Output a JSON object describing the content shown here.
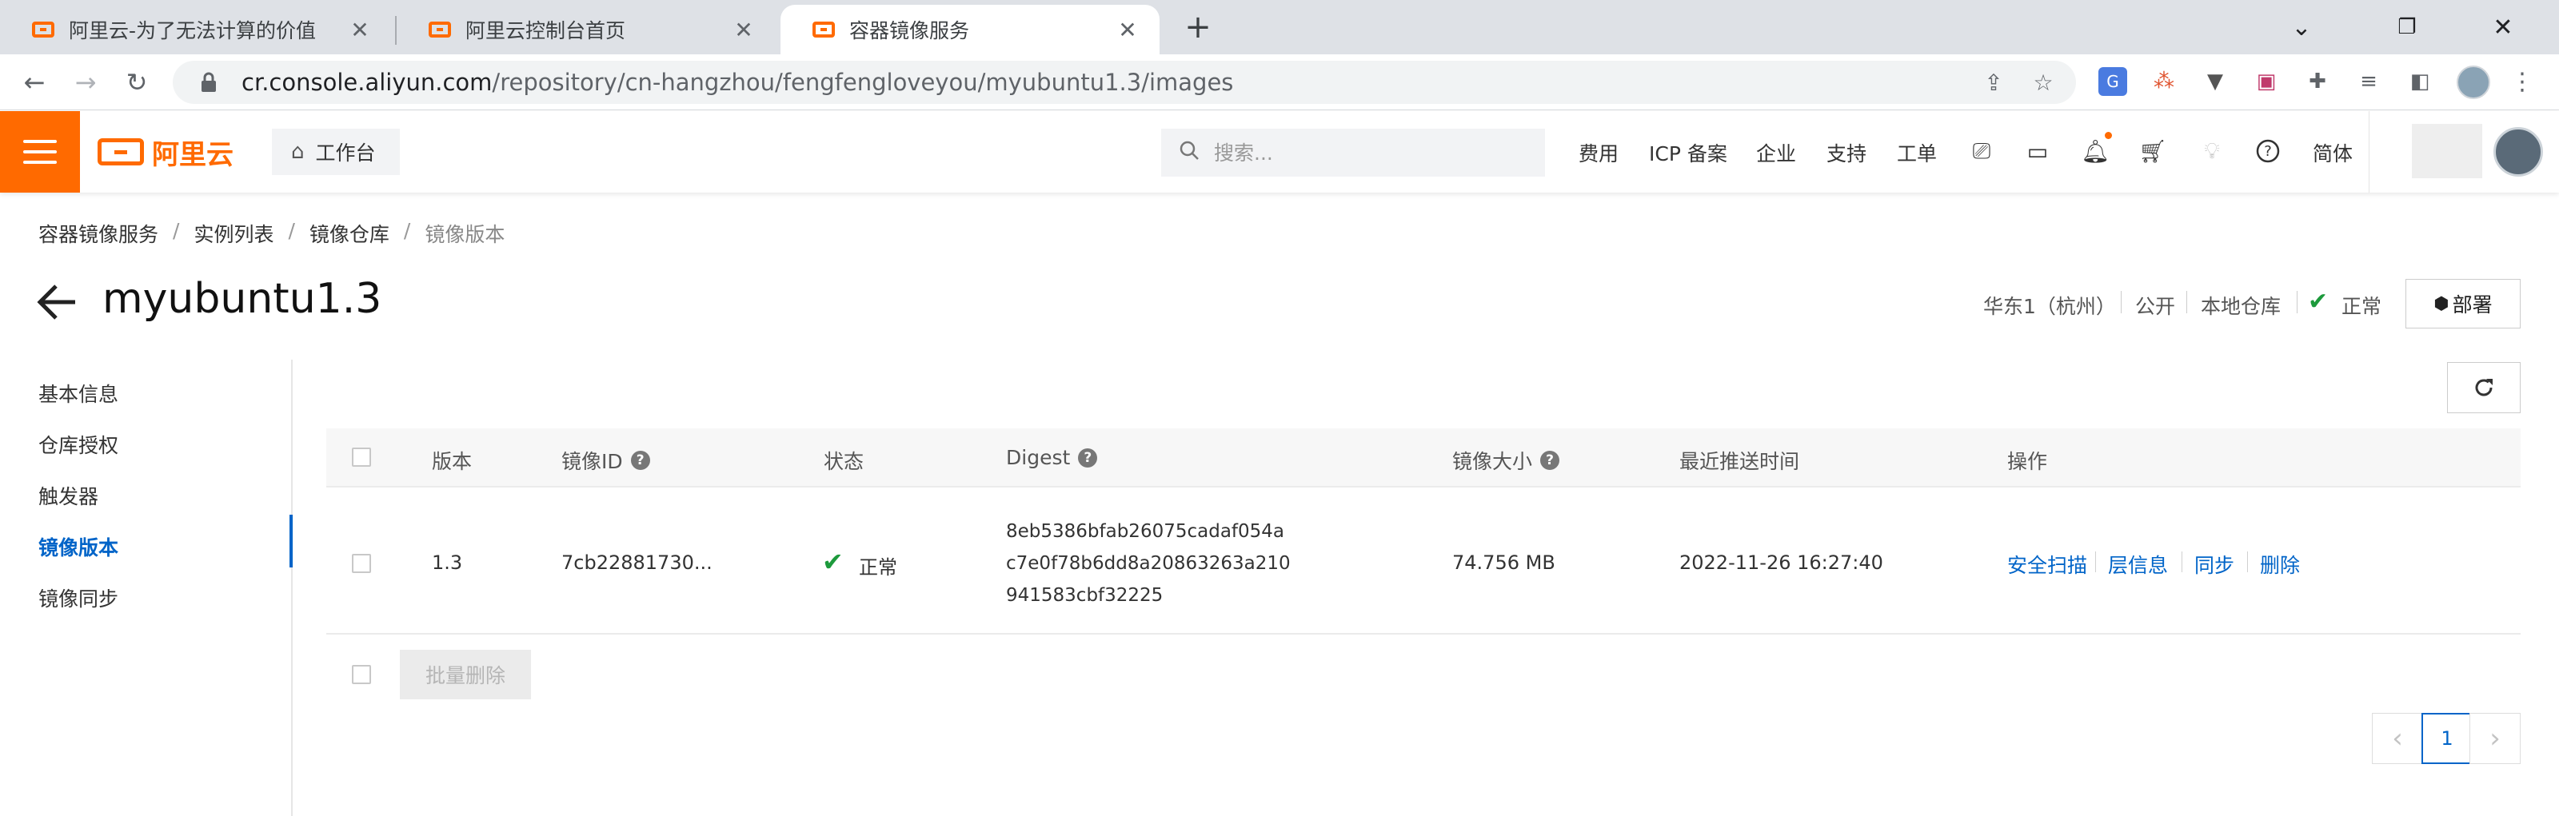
{
  "browser": {
    "tabs": [
      {
        "title": "阿里云-为了无法计算的价值",
        "close": "✕",
        "active": false
      },
      {
        "title": "阿里云控制台首页",
        "close": "✕",
        "active": false
      },
      {
        "title": "容器镜像服务",
        "close": "✕",
        "active": true
      }
    ],
    "new_tab": "+",
    "window_controls": {
      "minimize": "⌄",
      "restore": "❐",
      "close": "✕"
    },
    "address": {
      "host": "cr.console.aliyun.com",
      "path": "/repository/cn-hangzhou/fengfengloveyou/myubuntu1.3/images"
    }
  },
  "header": {
    "logo_text": "阿里云",
    "workbench_label": "工作台",
    "search_placeholder": "搜索...",
    "links": [
      "费用",
      "ICP 备案",
      "企业",
      "支持",
      "工单"
    ],
    "lang": "简体",
    "accent_color": "#ff6a00"
  },
  "breadcrumb": [
    "容器镜像服务",
    "实例列表",
    "镜像仓库",
    "镜像版本"
  ],
  "page": {
    "title": "myubuntu1.3",
    "region": "华东1（杭州）",
    "visibility": "公开",
    "repo_type": "本地仓库",
    "status": "正常",
    "deploy_label": "部署"
  },
  "sidebar": {
    "items": [
      "基本信息",
      "仓库授权",
      "触发器",
      "镜像版本",
      "镜像同步"
    ],
    "active_index": 3,
    "active_color": "#0064c8"
  },
  "table": {
    "columns": [
      "版本",
      "镜像ID",
      "状态",
      "Digest",
      "镜像大小",
      "最近推送时间",
      "操作"
    ],
    "rows": [
      {
        "version": "1.3",
        "image_id": "7cb22881730...",
        "status": "正常",
        "digest": [
          "8eb5386bfab26075cadaf054a",
          "c7e0f78b6dd8a20863263a210",
          "941583cbf32225"
        ],
        "size": "74.756 MB",
        "pushed_at": "2022-11-26 16:27:40",
        "actions": [
          "安全扫描",
          "层信息",
          "同步",
          "删除"
        ]
      }
    ],
    "batch_delete_label": "批量删除"
  },
  "pagination": {
    "prev": "‹",
    "current": "1",
    "next": "›"
  }
}
